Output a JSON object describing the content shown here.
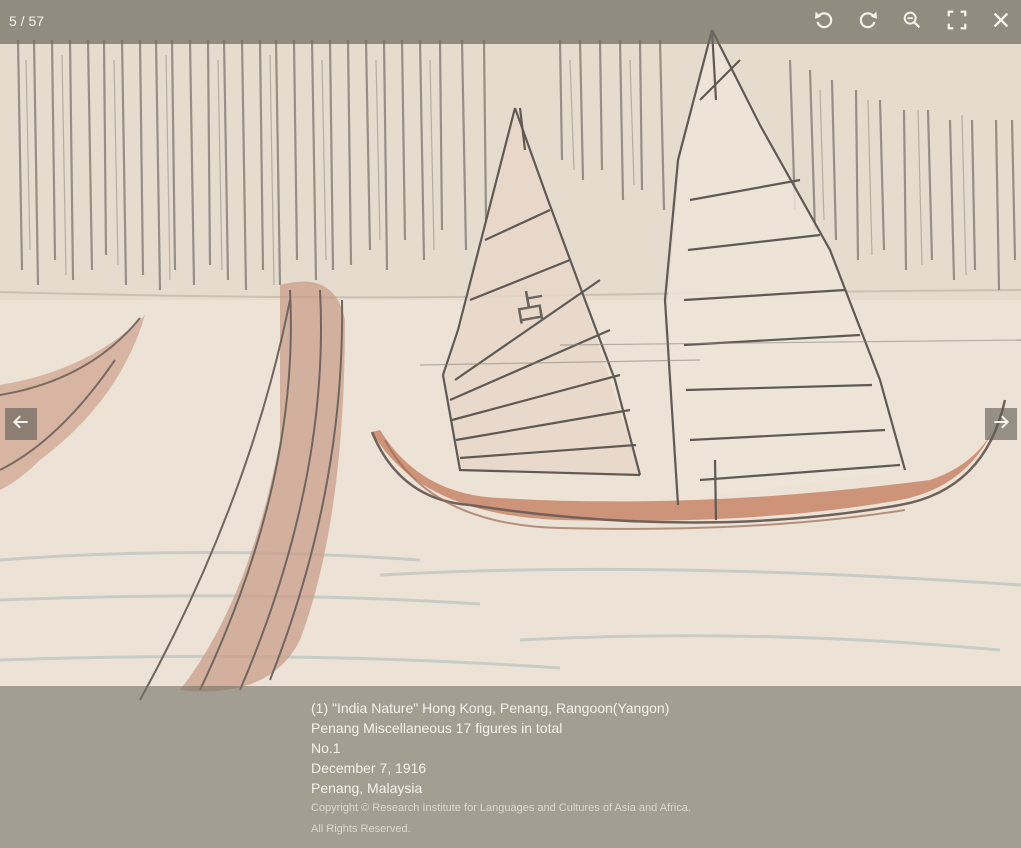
{
  "toolbar": {
    "counter": "5 / 57",
    "icons": [
      "rotate-left-icon",
      "rotate-right-icon",
      "zoom-out-icon",
      "fullscreen-icon",
      "close-icon"
    ]
  },
  "navigation": {
    "prev_icon": "arrow-left-icon",
    "next_icon": "arrow-right-icon"
  },
  "artwork": {
    "sail_glyph": "占"
  },
  "caption": {
    "title": "(1) \"India Nature\" Hong Kong, Penang, Rangoon(Yangon)",
    "subtitle": "Penang Miscellaneous 17 figures in total",
    "number": "No.1",
    "date": "December 7, 1916",
    "place": "Penang, Malaysia",
    "copyright": "Copyright © Research Institute for Languages and Cultures of Asia and Africa.",
    "rights": "All Rights Reserved."
  },
  "colors": {
    "paper": "#ece3d6",
    "pencil": "#6e6a64",
    "hull_wash": "#c78e74",
    "water": "#b9c3bf",
    "overlay": "#726c62",
    "text": "#f5f2ec"
  }
}
